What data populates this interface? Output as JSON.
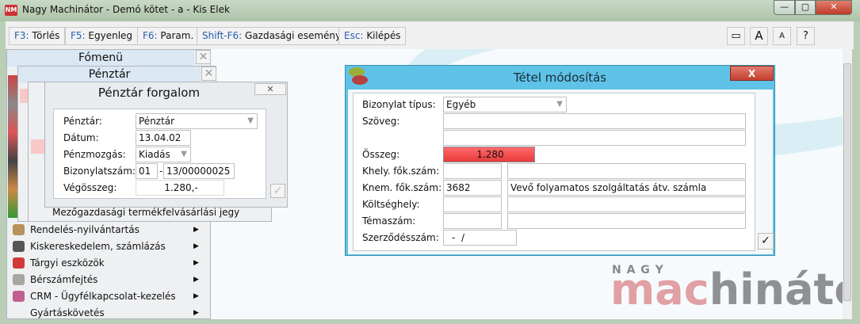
{
  "window": {
    "title": "Nagy Machinátor - Demó kötet - a - Kis Elek",
    "icon_text": "NM",
    "minimize": "—",
    "maximize": "▢",
    "close": "✕"
  },
  "toolbar": {
    "buttons": [
      {
        "key": "F3:",
        "label": "Törlés"
      },
      {
        "key": "F5:",
        "label": "Egyenleg"
      },
      {
        "key": "F6:",
        "label": "Param."
      },
      {
        "key": "Shift-F6:",
        "label": "Gazdasági esemény"
      },
      {
        "key": "Esc:",
        "label": "Kilépés"
      }
    ],
    "right": [
      "▭",
      "A",
      "A",
      "?"
    ]
  },
  "panels": {
    "fomenu": "Fómenü",
    "penztar": "Pénztár",
    "close": "✕"
  },
  "penztar_forgalom": {
    "title": "Pénztár forgalom",
    "close": "✕",
    "fields": {
      "penztar_label": "Pénztár:",
      "penztar": "Pénztár",
      "datum_label": "Dátum:",
      "datum": "13.04.02",
      "penzmozgas_label": "Pénzmozgás:",
      "penzmozgas": "Kiadás",
      "bizonylat_label": "Bizonylatszám:",
      "bizonylat_prefix": "01",
      "bizonylat_sep": "-",
      "bizonylat_num": "13/00000025",
      "vegosszeg_label": "Végösszeg:",
      "vegosszeg": "1.280,-"
    },
    "ok": "✓"
  },
  "menu": {
    "sub_item": "Mezőgazdasági termékfelvásárlási jegy",
    "items": [
      {
        "label": "Rendelés-nyilvántartás",
        "color": "#b8925a"
      },
      {
        "label": "Kiskereskedelem, számlázás",
        "color": "#555"
      },
      {
        "label": "Tárgyi eszközök",
        "color": "#d23a3a"
      },
      {
        "label": "Bérszámfejtés",
        "color": "#a8a8a0"
      },
      {
        "label": "CRM - Ügyfélkapcsolat-kezelés",
        "color": "#c06090"
      },
      {
        "label": "Gyártáskövetés",
        "color": "#888"
      }
    ],
    "arrow": "▶"
  },
  "tetel": {
    "title": "Tétel módosítás",
    "close": "X",
    "ok": "✓",
    "fields": {
      "bizonylat_tipus_label": "Bizonylat típus:",
      "bizonylat_tipus": "Egyéb",
      "szoveg_label": "Szöveg:",
      "szoveg1": "",
      "szoveg2": "",
      "osszeg_label": "Összeg:",
      "osszeg": "1.280",
      "khely_label": "Khely. fők.szám:",
      "khely_code": "",
      "khely_name": "",
      "knem_label": "Knem. fők.szám:",
      "knem_code": "3682",
      "knem_name": "Vevő folyamatos szolgáltatás átv. számla",
      "koltseghely_label": "Költséghely:",
      "koltseghely_code": "",
      "koltseghely_name": "",
      "temaszam_label": "Témaszám:",
      "temaszam_code": "",
      "temaszam_name": "",
      "szerzodes_label": "Szerződésszám:",
      "szerzodes": "-  /"
    }
  },
  "logo": {
    "top": "N A G Y",
    "part1": "mac",
    "part2": "hinátor"
  },
  "colors": {
    "accent": "#5ec3e6",
    "amount_red": "#f04848",
    "toolbar_key": "#2a5db0"
  }
}
